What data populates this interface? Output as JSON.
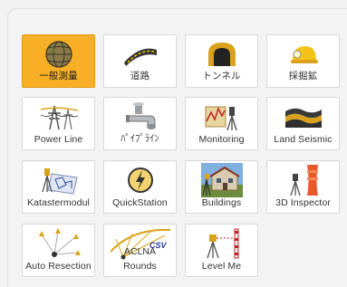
{
  "tiles": [
    {
      "label": "一般測量",
      "icon": "globe-icon",
      "selected": true
    },
    {
      "label": "道路",
      "icon": "road-icon"
    },
    {
      "label": "トンネル",
      "icon": "tunnel-icon"
    },
    {
      "label": "採掘鉱",
      "icon": "mining-helmet-icon"
    },
    {
      "label": "Power Line",
      "icon": "power-line-icon"
    },
    {
      "label": "ﾊﾟｲﾌﾟﾗｲﾝ",
      "icon": "pipeline-icon"
    },
    {
      "label": "Monitoring",
      "icon": "monitoring-icon"
    },
    {
      "label": "Land Seismic",
      "icon": "land-seismic-icon"
    },
    {
      "label": "Katastermodul",
      "icon": "cadastre-icon"
    },
    {
      "label": "QuickStation",
      "icon": "quickstation-icon"
    },
    {
      "label": "Buildings",
      "icon": "buildings-icon"
    },
    {
      "label": "3D Inspector",
      "icon": "3d-inspector-icon"
    },
    {
      "label": "Auto Resection",
      "icon": "auto-resection-icon"
    },
    {
      "label": "ACLNA / CSV Rounds",
      "icon": "rounds-icon",
      "icon_text": "ACLNA",
      "icon_badge": "CSV",
      "label_shown": "Rounds"
    },
    {
      "label": "Level Me",
      "icon": "level-me-icon"
    }
  ],
  "colors": {
    "selected": "#f7b025",
    "tile": "#ffffff",
    "background": "#f2f2f2"
  }
}
